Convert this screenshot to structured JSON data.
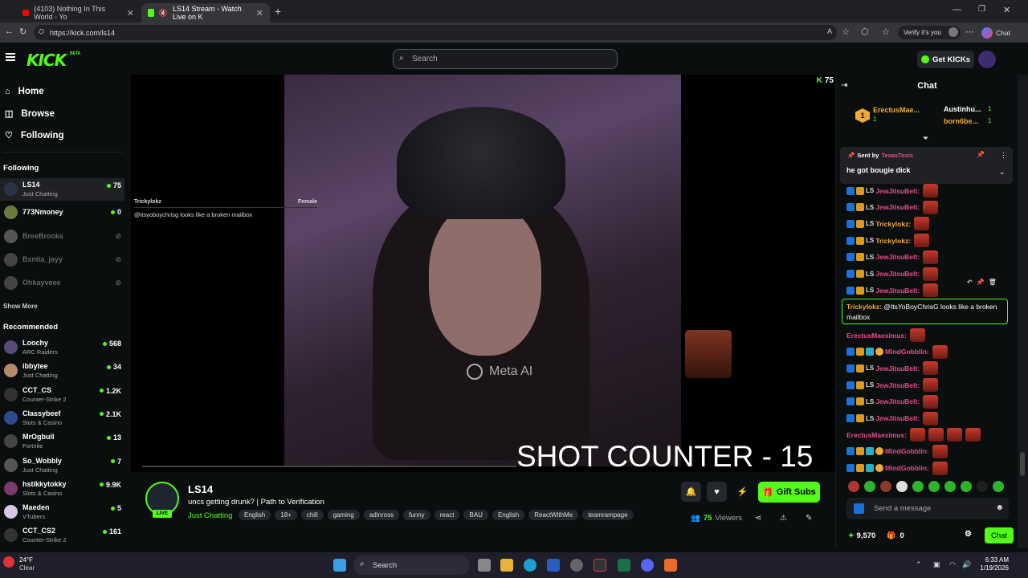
{
  "browser": {
    "tabs": [
      {
        "label": "(4103) Nothing In This World - Yo"
      },
      {
        "label": "LS14 Stream - Watch Live on K"
      }
    ],
    "url": "https://kick.com/ls14",
    "verify_label": "Verify it's you",
    "chat_label": "Chat"
  },
  "header": {
    "logo": "KICK",
    "beta": "BETA",
    "search_placeholder": "Search",
    "get_kicks": "Get KICKs"
  },
  "nav": {
    "items": [
      {
        "label": "Home",
        "icon": "home-icon"
      },
      {
        "label": "Browse",
        "icon": "compass-icon"
      },
      {
        "label": "Following",
        "icon": "heart-icon"
      }
    ]
  },
  "following": {
    "title": "Following",
    "channels": [
      {
        "name": "LS14",
        "category": "Just Chatting",
        "viewers": "75",
        "live": true
      },
      {
        "name": "773Nmoney",
        "category": "",
        "viewers": "0",
        "live": true
      },
      {
        "name": "BreeBrooks",
        "live": false
      },
      {
        "name": "Bxnita_jayy",
        "live": false
      },
      {
        "name": "Ohkayveee",
        "live": false
      }
    ],
    "show_more": "Show More"
  },
  "recommended": {
    "title": "Recommended",
    "channels": [
      {
        "name": "Loochy",
        "category": "ARC Raiders",
        "viewers": "568"
      },
      {
        "name": "ibbytee",
        "category": "Just Chatting",
        "viewers": "34"
      },
      {
        "name": "CCT_CS",
        "category": "Counter-Strike 2",
        "viewers": "1.2K"
      },
      {
        "name": "Classybeef",
        "category": "Slots & Casino",
        "viewers": "2.1K"
      },
      {
        "name": "MrOgbull",
        "category": "Fortnite",
        "viewers": "13"
      },
      {
        "name": "So_Wobbly",
        "category": "Just Chatting",
        "viewers": "7"
      },
      {
        "name": "hstikkytokky",
        "category": "Slots & Casino",
        "viewers": "9.9K"
      },
      {
        "name": "Maeden",
        "category": "VTubers",
        "viewers": "5"
      },
      {
        "name": "CCT_CS2",
        "category": "Counter-Strike 2",
        "viewers": "161"
      }
    ]
  },
  "player": {
    "viewer_count": "75",
    "overlay_user": "Trickylokz",
    "overlay_gender": "Female",
    "overlay_msg": "@itsyoboychrisg looks like a broken mailbox",
    "meta_ai": "Meta AI",
    "shot_counter": "SHOT COUNTER - 15"
  },
  "stream": {
    "name": "LS14",
    "live": "LIVE",
    "title": "uncs getting drunk? | Path to Verification",
    "category": "Just Chatting",
    "tags": [
      "English",
      "18+",
      "chill",
      "gaming",
      "adinross",
      "funny",
      "react",
      "BAU",
      "English",
      "ReactWithMe",
      "teamrampage"
    ],
    "gift_subs": "Gift Subs",
    "viewers": "75",
    "viewers_label": "Viewers"
  },
  "chat": {
    "title": "Chat",
    "gifters": [
      {
        "rank": "1",
        "name": "ErectusMae...",
        "count": "1"
      },
      {
        "name": "Austinhu...",
        "count": "1"
      },
      {
        "name": "born6be...",
        "count": "1"
      }
    ],
    "pinned": {
      "sent_by": "Sent by",
      "user": "TexasToxic",
      "text": "he got bougie dick"
    },
    "messages": [
      {
        "user": "JewJitsuBelt:",
        "color": "#e94b8b"
      },
      {
        "user": "JewJitsuBelt:",
        "color": "#e94b8b"
      },
      {
        "user": "Trickylokz:",
        "color": "#f0a93b"
      },
      {
        "user": "Trickylokz:",
        "color": "#f0a93b"
      },
      {
        "user": "JewJitsuBelt:",
        "color": "#e94b8b"
      },
      {
        "user": "JewJitsuBelt:",
        "color": "#e94b8b"
      },
      {
        "user": "JewJitsuBelt:",
        "color": "#e94b8b"
      }
    ],
    "reply": {
      "user": "Trickylokz:",
      "text": "@ItsYoBoyChrisG looks like a broken mailbox"
    },
    "messages2": [
      {
        "user": "ErectusMaeximus:",
        "color": "#e94b8b"
      },
      {
        "user": "MindGobblin:",
        "color": "#e94b8b"
      },
      {
        "user": "JewJitsuBelt:",
        "color": "#e94b8b"
      },
      {
        "user": "JewJitsuBelt:",
        "color": "#e94b8b"
      },
      {
        "user": "JewJitsuBelt:",
        "color": "#e94b8b"
      },
      {
        "user": "JewJitsuBelt:",
        "color": "#e94b8b"
      },
      {
        "user": "ErectusMaeximus:",
        "color": "#e94b8b"
      },
      {
        "user": "MindGobblin:",
        "color": "#e94b8b"
      },
      {
        "user": "MindGobblin:",
        "color": "#e94b8b"
      }
    ],
    "send_placeholder": "Send a message",
    "points": "9,570",
    "gifts": "0",
    "chat_button": "Chat"
  },
  "taskbar": {
    "temp": "24°F",
    "weather": "Clear",
    "search": "Search",
    "time": "6:33 AM",
    "date": "1/19/2026"
  }
}
